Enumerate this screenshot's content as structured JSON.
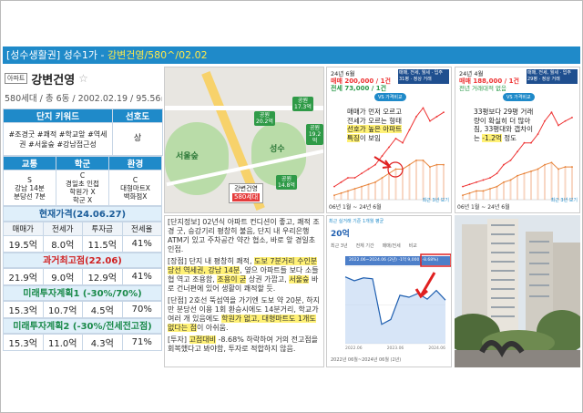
{
  "header": {
    "prefix": "[성수생활권] 성수1가 - ",
    "highlight": "강변건영/580^/02.02"
  },
  "apartment": {
    "tag": "아파트",
    "name": "강변건영",
    "star": "☆",
    "info": "580세대 / 총 6동 / 2002.02.19 / 95.56㎡"
  },
  "keywords": {
    "header_keyword": "단지 키워드",
    "header_pref": "선호도",
    "keywords_text": "#조경굿 #쾌적 #학교앞 #역세권 #서울숲 #강남접근성",
    "preference": "상"
  },
  "location": {
    "h_traffic": "교통",
    "h_school": "학군",
    "h_env": "환경",
    "traffic_grade": "S",
    "traffic_desc": "강남 14분\n분당선 7분",
    "school_grade": "C",
    "school_desc": "경일초 인접\n학원가 X\n학군 X",
    "env_grade": "C",
    "env_desc": "대형마트X\n백화점X"
  },
  "current_price": {
    "title": "현재가격(24.06.27)",
    "cols": [
      "매매가",
      "전세가",
      "투자금",
      "전세율"
    ],
    "values": [
      "19.5억",
      "8.0억",
      "11.5억",
      "41%"
    ]
  },
  "past_peak": {
    "title": "과거최고점(22.06)",
    "values": [
      "21.9억",
      "9.0억",
      "12.9억",
      "41%"
    ]
  },
  "future1": {
    "title": "미래투자계획1 (-30%/70%)",
    "values": [
      "15.3억",
      "10.7억",
      "4.5억",
      "70%"
    ]
  },
  "future2": {
    "title": "미래투자계획2 (-30%/전세전고점)",
    "values": [
      "15.3억",
      "11.0억",
      "4.3억",
      "71%"
    ]
  },
  "map": {
    "label_seoulforest": "서울숲",
    "label_park": "성수",
    "pin1": "공원\n20.2억",
    "pin2": "공원\n17.3억",
    "pin3": "공원\n19.2억",
    "pin4": "공원\n14.8억",
    "apt_pin_name": "강변건영",
    "apt_pin_price": "580세대"
  },
  "description": {
    "p1": "[단지정보] 02년식 아파트 컨디션이 좋고, 쾌적 조경 굿, 승강기리 평창히 불음, 단지 내 우리은행 ATM기 있고 주차공간 약간 협소, 바로 앞 경일초 인접.",
    "p2_a": "[장점] 단지 내 평창히 쾌적, ",
    "p2_hl1": "도보 7분거리 수인분당선 역세권, 강남 14분",
    "p2_b": ", 옆으 아파트들 보다 소들 협 역고 조용함, ",
    "p2_hl2": "조용이 굳",
    "p2_c": " 상권 가깝고, ",
    "p2_hl3": "서울숲",
    "p2_d": " 바로 건너편에 있어 생활이 쾌적할 듯.",
    "p3_a": "[단점] 2호선 뚝섬역을 가기엔 도보 약 20분, 하지만 분당선 이용 1회 환승시에도 14분거리, 학교가 여러 개 있음에도 ",
    "p3_hl": "학원가 없고, 대형마트도 1개도 없다는 점",
    "p3_b": "이 아쉬움.",
    "p4_a": "[투자] ",
    "p4_hl": "고점대비",
    "p4_b": " -8.68% 하락하여 거의 전고점을 회복했다고 봐야함, 투자로 적합하지 않음."
  },
  "chart1": {
    "period_label": "24년 6월",
    "sale_label": "매매 200,000 / 1건",
    "jeonse_label": "전세 73,000 / 1건",
    "box": "매매, 전세, 월세 · 입주\n31평 · 정상 거래",
    "vs_label": "VS 가격비교",
    "note_a": "매매가 먼저 오르고\n전세가 오르는 형태\n",
    "note_hl": "선호가 높은 아파트\n특징",
    "note_b": "이 보임",
    "foot": "06년 1월 ~ 24년 6월",
    "foot2": "최근 3년 보기"
  },
  "chart2": {
    "period_label": "24년 4월",
    "sale_label": "매매 188,000 / 1건",
    "sub_label": "전년 거래대적 없음",
    "box": "매매, 전세, 월세 · 입주\n29평 · 정상 거래",
    "vs_label": "VS 가격비교",
    "note_a": "33평보다 29평 거래\n량이 확실히 더 많아\n짐, 33평대와 갭차이\n는 ",
    "note_hl": "-1.2억",
    "note_b": " 정도",
    "foot": "06년 1월 ~ 24년 6월",
    "foot2": "최근 3년 보기"
  },
  "chart3": {
    "top": "최근 실거래 기준 1개월 평균",
    "price": "20억",
    "tabs": [
      "최근 3년",
      "전체 기간",
      "매매/전세",
      "비교"
    ],
    "range_label": "2022.06~2024.06 (2년) -1억 9,000 (-8.68%)",
    "years": [
      "2022.06",
      "2023.06",
      "2024.06"
    ],
    "foot": "2022년 06월~2024년 06월 (2년)"
  },
  "chart_data": [
    {
      "type": "line",
      "title": "",
      "series": [
        {
          "name": "매매",
          "color": "#e33",
          "values": [
            3,
            4,
            5,
            5,
            6,
            7,
            8,
            10,
            12,
            14,
            13,
            16,
            19,
            21,
            18,
            19,
            20
          ]
        },
        {
          "name": "전세",
          "color": "#e8843a",
          "values": [
            1,
            1.5,
            2,
            2.5,
            3,
            3.5,
            4,
            5,
            6,
            7,
            7,
            8,
            9,
            9,
            7.5,
            8,
            8
          ]
        }
      ]
    },
    {
      "type": "line",
      "title": "",
      "series": [
        {
          "name": "매매",
          "color": "#e33",
          "values": [
            3,
            3.5,
            4,
            4.5,
            5,
            6,
            8,
            9,
            11,
            13,
            13,
            15,
            18,
            20,
            17,
            18,
            18.8
          ]
        },
        {
          "name": "전세",
          "color": "#e8843a",
          "values": [
            1,
            1.5,
            2,
            2,
            2.5,
            3,
            4,
            4.5,
            5.5,
            6,
            6.5,
            7,
            8,
            8.5,
            7,
            7.5,
            7.5
          ]
        }
      ]
    },
    {
      "type": "line",
      "title": "",
      "x": [
        "2022.06",
        "2023.06",
        "2024.06"
      ],
      "series": [
        {
          "name": "",
          "color": "#1f5fb0",
          "values": [
            21.9,
            21.5,
            21.8,
            21.7,
            17.0,
            17.5,
            20.0,
            19.8,
            20.2,
            19.6,
            20.5,
            19.5
          ]
        }
      ]
    }
  ]
}
